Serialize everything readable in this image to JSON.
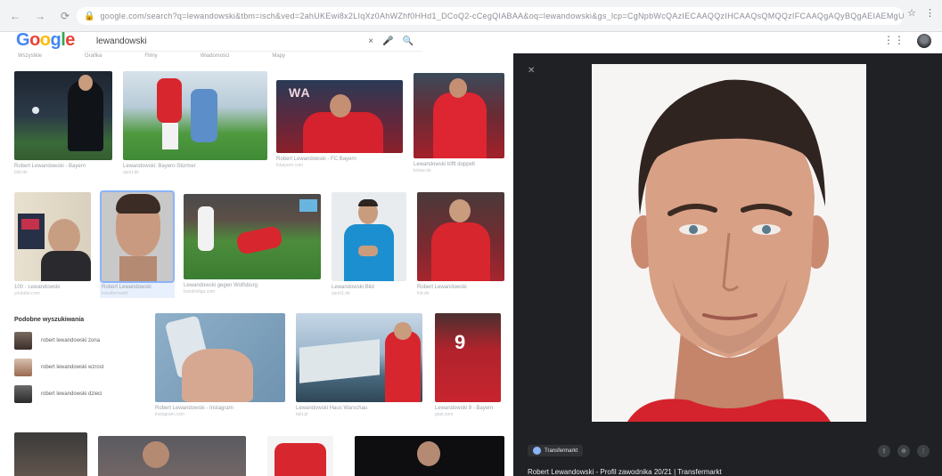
{
  "browser": {
    "url": "google.com/search?q=lewandowski&tbm=isch&ved=2ahUKEwi8x2LIqXz0AhWZhf0HHd1_DCoQ2-cCegQIABAA&oq=lewandowski&gs_lcp=CgNpbWcQAzIECAAQQzIHCAAQsQMQQzIFCAAQgAQyBQgAEIAEMgUIABCABDIFCAAQgAQyBQgAEIAEMgUIABCABDoECCMQJ1CbBVicDmDSEGgAcAB4AIAB",
    "nav": [
      "←",
      "→",
      "⟳",
      "⌂"
    ],
    "right_icons": [
      "☆",
      "⋮"
    ]
  },
  "header": {
    "logo_letters": [
      "G",
      "o",
      "o",
      "g",
      "l",
      "e"
    ],
    "search_value": "lewandowski",
    "icons": [
      "×",
      "🎤",
      "🔍"
    ]
  },
  "filters": [
    "Wszystkie",
    "Grafika",
    "Filmy",
    "Wiadomości",
    "Mapy"
  ],
  "tiles": [
    {
      "caption": "Robert Lewandowski - Bayern",
      "source": "bild.de"
    },
    {
      "caption": "Lewandowski: Bayern-Stürmer",
      "source": "sport.de"
    },
    {
      "caption": "Robert Lewandowski - FC Bayern",
      "source": "fcbayern.com"
    },
    {
      "caption": "Lewandowski trifft doppelt",
      "source": "kicker.de"
    },
    {
      "caption": "100 - Lewandowski",
      "source": "youtube.com"
    },
    {
      "caption": "Robert Lewandowski",
      "source": "transfermarkt"
    },
    {
      "caption": "Lewandowski gegen Wolfsburg",
      "source": "bundesliga.com"
    },
    {
      "caption": "Lewandowski Bild",
      "source": "sport1.de"
    },
    {
      "caption": "Robert Lewandowski",
      "source": "fcb.de"
    },
    {
      "caption": "Robert Lewandowski - Instagram",
      "source": "instagram.com"
    },
    {
      "caption": "Lewandowski Haus Warschau",
      "source": "fakt.pl"
    },
    {
      "caption": "Lewandowski 9 - Bayern",
      "source": "goal.com"
    }
  ],
  "people": {
    "title": "Podobne wyszukiwania",
    "items": [
      "robert lewandowski żona",
      "robert lewandowski wzrost",
      "robert lewandowski dzieci"
    ]
  },
  "viewer": {
    "source": "Transfermarkt",
    "title": "Robert Lewandowski - Profil zawodnika 20/21 | Transfermarkt",
    "actions": [
      "⇪",
      "⊕",
      "⋮"
    ]
  }
}
